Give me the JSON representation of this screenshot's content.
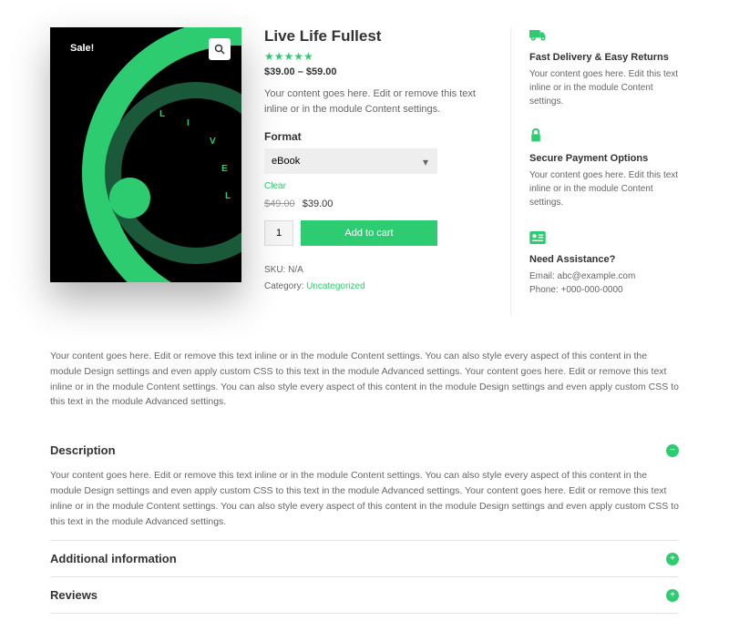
{
  "product": {
    "sale_badge": "Sale!",
    "title": "Live Life Fullest",
    "price_range": "$39.00 – $59.00",
    "description": "Your content goes here. Edit or remove this text inline or in the module Content settings.",
    "format_label": "Format",
    "format_selected": "eBook",
    "clear_label": "Clear",
    "original_price": "$49.00",
    "sale_price": "$39.00",
    "qty": "1",
    "add_to_cart": "Add to cart",
    "sku_label": "SKU:",
    "sku_value": "N/A",
    "category_label": "Category:",
    "category_value": "Uncategorized"
  },
  "sidebar": {
    "delivery": {
      "title": "Fast Delivery & Easy Returns",
      "text": "Your content goes here. Edit this text inline or in the module Content settings."
    },
    "payment": {
      "title": "Secure Payment Options",
      "text": "Your content goes here. Edit this text inline or in the module Content settings."
    },
    "assist": {
      "title": "Need Assistance?",
      "email": "Email: abc@example.com",
      "phone": "Phone: +000-000-0000"
    }
  },
  "longtext": "Your content goes here. Edit or remove this text inline or in the module Content settings. You can also style every aspect of this content in the module Design settings and even apply custom CSS to this text in the module Advanced settings. Your content goes here. Edit or remove this text inline or in the module Content settings. You can also style every aspect of this content in the module Design settings and even apply custom CSS to this text in the module Advanced settings.",
  "accordion": {
    "description": {
      "title": "Description",
      "body": "Your content goes here. Edit or remove this text inline or in the module Content settings. You can also style every aspect of this content in the module Design settings and even apply custom CSS to this text in the module Advanced settings. Your content goes here. Edit or remove this text inline or in the module Content settings. You can also style every aspect of this content in the module Design settings and even apply custom CSS to this text in the module Advanced settings."
    },
    "additional": {
      "title": "Additional information"
    },
    "reviews": {
      "title": "Reviews"
    }
  }
}
